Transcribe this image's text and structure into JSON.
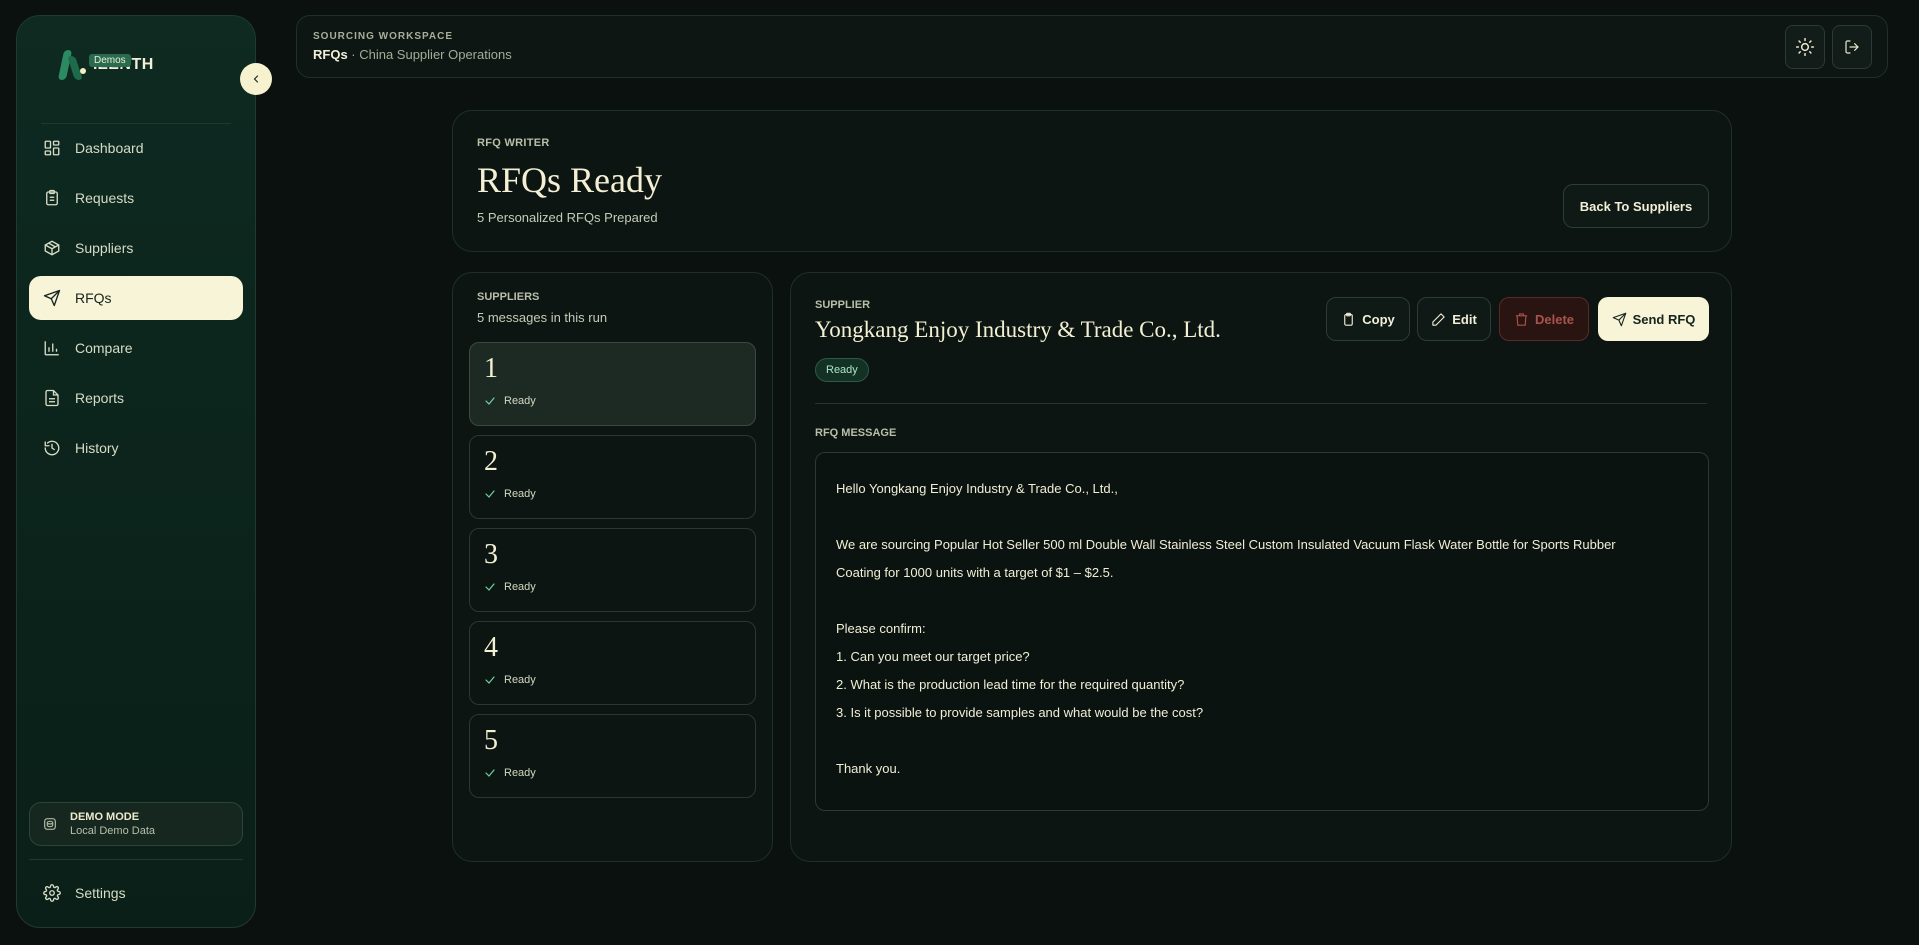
{
  "sidebar": {
    "logo_text": "IZENTH",
    "logo_badge": "Demos",
    "collapse_icon": "chevron-left-icon",
    "items": [
      {
        "label": "Dashboard",
        "icon": "dashboard-icon",
        "active": false
      },
      {
        "label": "Requests",
        "icon": "clipboard-icon",
        "active": false
      },
      {
        "label": "Suppliers",
        "icon": "package-icon",
        "active": false
      },
      {
        "label": "RFQs",
        "icon": "send-icon",
        "active": true
      },
      {
        "label": "Compare",
        "icon": "bar-chart-icon",
        "active": false
      },
      {
        "label": "Reports",
        "icon": "file-text-icon",
        "active": false
      },
      {
        "label": "History",
        "icon": "history-icon",
        "active": false
      }
    ],
    "demo": {
      "title": "DEMO MODE",
      "subtitle": "Local Demo Data"
    },
    "settings_label": "Settings"
  },
  "topbar": {
    "kicker": "SOURCING WORKSPACE",
    "crumb_strong": "RFQs",
    "crumb_rest": " · China Supplier Operations"
  },
  "header": {
    "kicker": "RFQ WRITER",
    "title": "RFQs Ready",
    "subtitle": "5 Personalized RFQs Prepared",
    "back_label": "Back To Suppliers"
  },
  "suppliers_panel": {
    "kicker": "SUPPLIERS",
    "subtitle": "5 messages in this run",
    "items": [
      {
        "number": "1",
        "status": "Ready",
        "active": true
      },
      {
        "number": "2",
        "status": "Ready",
        "active": false
      },
      {
        "number": "3",
        "status": "Ready",
        "active": false
      },
      {
        "number": "4",
        "status": "Ready",
        "active": false
      },
      {
        "number": "5",
        "status": "Ready",
        "active": false
      }
    ]
  },
  "detail": {
    "kicker": "SUPPLIER",
    "name": "Yongkang Enjoy Industry & Trade Co., Ltd.",
    "badge": "Ready",
    "copy_label": "Copy",
    "edit_label": "Edit",
    "delete_label": "Delete",
    "send_label": "Send RFQ",
    "message_kicker": "RFQ MESSAGE",
    "message_lines": [
      "Hello Yongkang Enjoy Industry & Trade Co., Ltd.,",
      "",
      "We are sourcing Popular Hot Seller 500 ml Double Wall Stainless Steel Custom Insulated Vacuum Flask Water Bottle for Sports Rubber",
      "Coating for 1000 units with a target of $1 – $2.5.",
      "",
      "Please confirm:",
      "1. Can you meet our target price?",
      "2. What is the production lead time for the required quantity?",
      "3. Is it possible to provide samples and what would be the cost?",
      "",
      "Thank you."
    ]
  },
  "colors": {
    "accent": "#f8f4d8",
    "background": "#0b110e",
    "sidebar": "#0e2a21",
    "ready": "#a9e6c7",
    "danger": "#a8534b"
  }
}
